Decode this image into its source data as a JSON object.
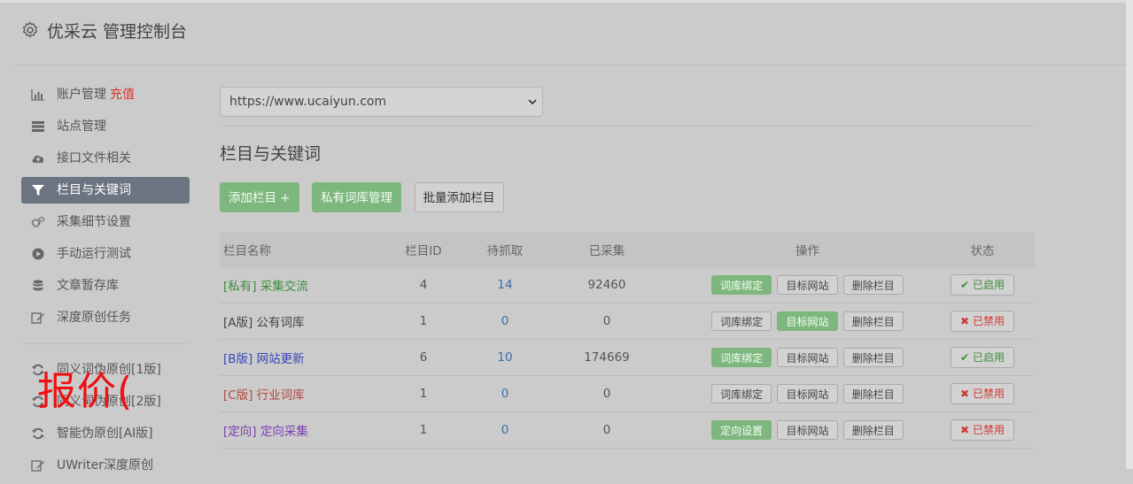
{
  "header": {
    "title": "优采云 管理控制台"
  },
  "sidebar": {
    "items": [
      {
        "label": "账户管理",
        "extra": "充值",
        "icon": "bar-chart-icon"
      },
      {
        "label": "站点管理",
        "icon": "server-icon"
      },
      {
        "label": "接口文件相关",
        "icon": "cloud-upload-icon"
      },
      {
        "label": "栏目与关键词",
        "icon": "filter-icon",
        "active": true
      },
      {
        "label": "采集细节设置",
        "icon": "cogs-icon"
      },
      {
        "label": "手动运行测试",
        "icon": "play-circle-icon"
      },
      {
        "label": "文章暂存库",
        "icon": "database-icon"
      },
      {
        "label": "深度原创任务",
        "icon": "edit-icon"
      }
    ],
    "items2": [
      {
        "label": "同义词伪原创[1版]",
        "icon": "refresh-icon"
      },
      {
        "label": "同义词伪原创[2版]",
        "icon": "refresh-icon"
      },
      {
        "label": "智能伪原创[AI版]",
        "icon": "refresh-icon"
      },
      {
        "label": "UWriter深度原创",
        "icon": "edit-icon"
      }
    ]
  },
  "overlay": {
    "text": "报价("
  },
  "main": {
    "site_select": {
      "value": "https://www.ucaiyun.com"
    },
    "section_title": "栏目与关键词",
    "buttons": {
      "add": "添加栏目 +",
      "private_lib": "私有词库管理",
      "batch_add": "批量添加栏目"
    },
    "table": {
      "headers": {
        "name": "栏目名称",
        "id": "栏目ID",
        "pending": "待抓取",
        "collected": "已采集",
        "ops": "操作",
        "status": "状态"
      },
      "rows": [
        {
          "name": "[私有] 采集交流",
          "id": "4",
          "pending": "14",
          "collected": "92460",
          "op1": "词库绑定",
          "op2": "目标网站",
          "op3": "删除栏目",
          "status": "已启用"
        },
        {
          "name": "[A版] 公有词库",
          "id": "1",
          "pending": "0",
          "collected": "0",
          "op1": "词库绑定",
          "op2": "目标网站",
          "op3": "删除栏目",
          "status": "已禁用"
        },
        {
          "name": "[B版] 网站更新",
          "id": "6",
          "pending": "10",
          "collected": "174669",
          "op1": "词库绑定",
          "op2": "目标网站",
          "op3": "删除栏目",
          "status": "已启用"
        },
        {
          "name": "[C版] 行业词库",
          "id": "1",
          "pending": "0",
          "collected": "0",
          "op1": "词库绑定",
          "op2": "目标网站",
          "op3": "删除栏目",
          "status": "已禁用"
        },
        {
          "name": "[定向] 定向采集",
          "id": "1",
          "pending": "0",
          "collected": "0",
          "op1": "定向设置",
          "op2": "目标网站",
          "op3": "删除栏目",
          "status": "已禁用"
        }
      ]
    }
  },
  "colors": {
    "accent_green": "#7db77d",
    "active_nav": "#6b7480",
    "recharge_red": "#d9342b",
    "overlay_red": "#ee1111"
  }
}
